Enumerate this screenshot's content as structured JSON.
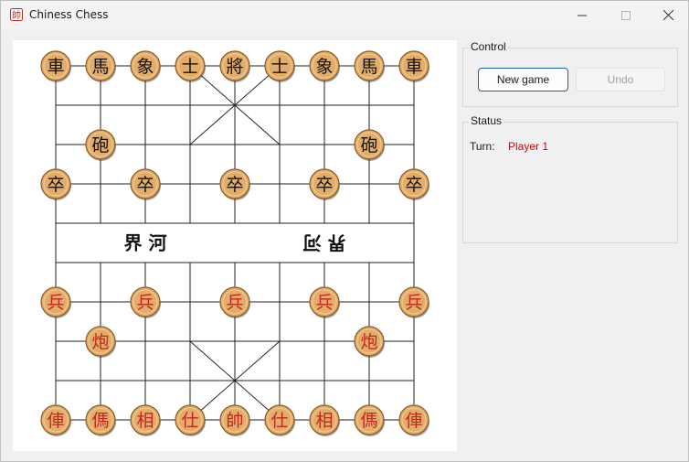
{
  "window": {
    "title": "Chiness Chess"
  },
  "control": {
    "group_label": "Control",
    "new_game_label": "New game",
    "undo_label": "Undo"
  },
  "status": {
    "group_label": "Status",
    "turn_label": "Turn:",
    "turn_value": "Player 1",
    "turn_color": "#d40000"
  },
  "board": {
    "river_left": "界 河",
    "river_right": "界 河",
    "black_pieces": [
      {
        "char": "車",
        "col": 0,
        "row": 0
      },
      {
        "char": "馬",
        "col": 1,
        "row": 0
      },
      {
        "char": "象",
        "col": 2,
        "row": 0
      },
      {
        "char": "士",
        "col": 3,
        "row": 0
      },
      {
        "char": "將",
        "col": 4,
        "row": 0
      },
      {
        "char": "士",
        "col": 5,
        "row": 0
      },
      {
        "char": "象",
        "col": 6,
        "row": 0
      },
      {
        "char": "馬",
        "col": 7,
        "row": 0
      },
      {
        "char": "車",
        "col": 8,
        "row": 0
      },
      {
        "char": "砲",
        "col": 1,
        "row": 2
      },
      {
        "char": "砲",
        "col": 7,
        "row": 2
      },
      {
        "char": "卒",
        "col": 0,
        "row": 3
      },
      {
        "char": "卒",
        "col": 2,
        "row": 3
      },
      {
        "char": "卒",
        "col": 4,
        "row": 3
      },
      {
        "char": "卒",
        "col": 6,
        "row": 3
      },
      {
        "char": "卒",
        "col": 8,
        "row": 3
      }
    ],
    "red_pieces": [
      {
        "char": "兵",
        "col": 0,
        "row": 6
      },
      {
        "char": "兵",
        "col": 2,
        "row": 6
      },
      {
        "char": "兵",
        "col": 4,
        "row": 6
      },
      {
        "char": "兵",
        "col": 6,
        "row": 6
      },
      {
        "char": "兵",
        "col": 8,
        "row": 6
      },
      {
        "char": "炮",
        "col": 1,
        "row": 7
      },
      {
        "char": "炮",
        "col": 7,
        "row": 7
      },
      {
        "char": "俥",
        "col": 0,
        "row": 9
      },
      {
        "char": "傌",
        "col": 1,
        "row": 9
      },
      {
        "char": "相",
        "col": 2,
        "row": 9
      },
      {
        "char": "仕",
        "col": 3,
        "row": 9
      },
      {
        "char": "帥",
        "col": 4,
        "row": 9
      },
      {
        "char": "仕",
        "col": 5,
        "row": 9
      },
      {
        "char": "相",
        "col": 6,
        "row": 9
      },
      {
        "char": "傌",
        "col": 7,
        "row": 9
      },
      {
        "char": "俥",
        "col": 8,
        "row": 9
      }
    ],
    "colors": {
      "black_text": "#111111",
      "red_text": "#c0281e",
      "piece_fill": "#e2ac6a",
      "piece_edge": "#8a5a22"
    }
  }
}
